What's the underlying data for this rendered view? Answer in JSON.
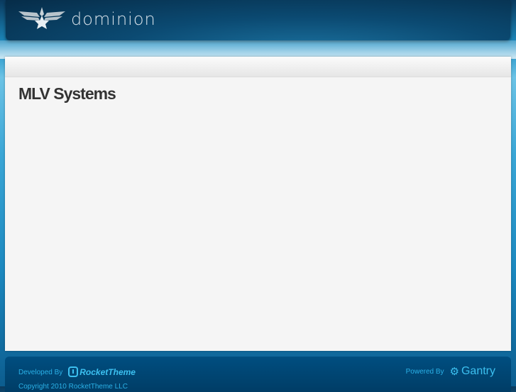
{
  "header": {
    "logo_text": "dominion"
  },
  "main": {
    "title": "MLV Systems"
  },
  "footer": {
    "developed_by": "Developed By",
    "developer": "RocketTheme",
    "powered_by": "Powered By",
    "powered": "Gantry",
    "copyright": "Copyright 2010 RocketTheme LLC"
  }
}
